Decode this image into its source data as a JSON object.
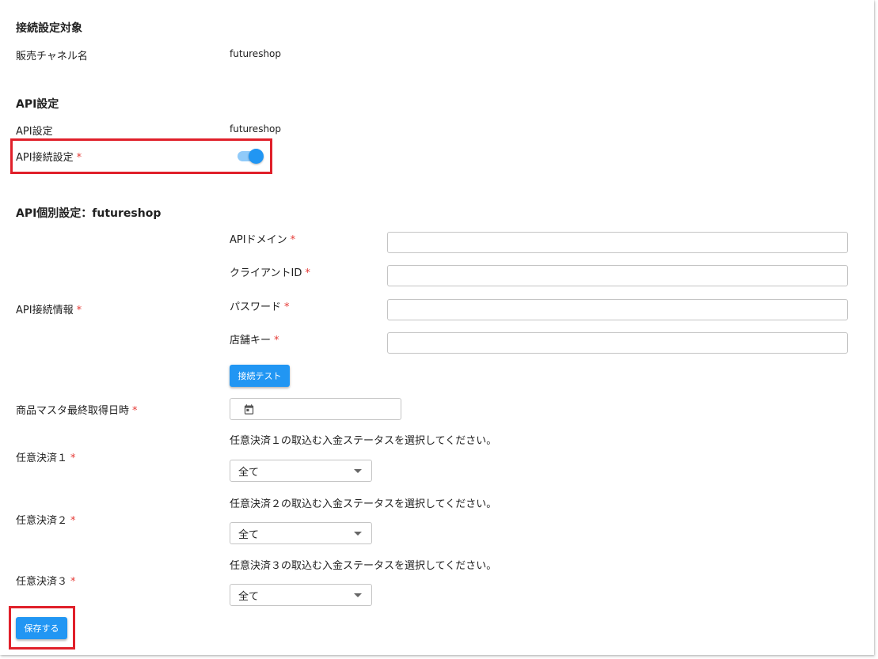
{
  "target_section": {
    "title": "接続設定対象",
    "channel_label": "販売チャネル名",
    "channel_value": "futureshop"
  },
  "api_section": {
    "title": "API設定",
    "api_label": "API設定",
    "api_value": "futureshop",
    "connection_label": "API接続設定",
    "connection_enabled": true
  },
  "individual_section": {
    "title": "API個別設定：futureshop",
    "connection_info_label": "API接続情報",
    "fields": [
      {
        "label": "APIドメイン",
        "value": ""
      },
      {
        "label": "クライアントID",
        "value": ""
      },
      {
        "label": "パスワード",
        "value": ""
      },
      {
        "label": "店舗キー",
        "value": ""
      }
    ],
    "test_button": "接続テスト",
    "last_fetch_label": "商品マスタ最終取得日時",
    "last_fetch_value": ""
  },
  "payments": [
    {
      "label": "任意決済１",
      "hint": "任意決済１の取込む入金ステータスを選択してください。",
      "selected": "全て"
    },
    {
      "label": "任意決済２",
      "hint": "任意決済２の取込む入金ステータスを選択してください。",
      "selected": "全て"
    },
    {
      "label": "任意決済３",
      "hint": "任意決済３の取込む入金ステータスを選択してください。",
      "selected": "全て"
    }
  ],
  "required_mark": "*",
  "save_button": "保存する",
  "colors": {
    "accent": "#2196f3",
    "toggle_track": "#90caf9",
    "required": "#e53935",
    "highlight_box": "#e0202a"
  },
  "icons": {
    "calendar": "calendar-icon",
    "dropdown": "chevron-down-icon"
  }
}
